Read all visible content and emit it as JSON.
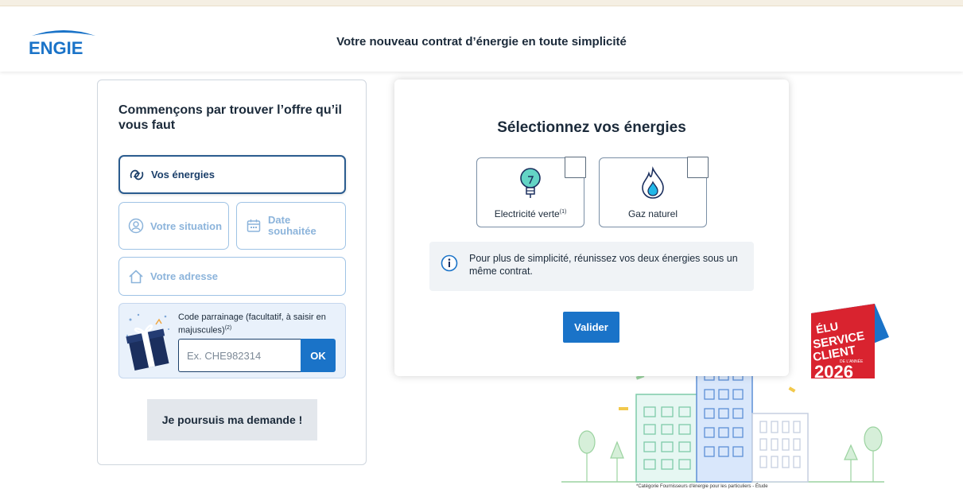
{
  "header": {
    "brand": "ENGIE",
    "title": "Votre nouveau contrat d’énergie en toute simplicité"
  },
  "left_panel": {
    "title": "Commençons par trouver l’offre qu’il vous faut",
    "steps": {
      "energies": "Vos énergies",
      "situation": "Votre situation",
      "date": "Date souhaitée",
      "adresse": "Votre adresse"
    },
    "promo": {
      "label": "Code parrainage (facultatif, à saisir en majuscules)",
      "label_note": "(2)",
      "placeholder": "Ex. CHE982314",
      "ok": "OK"
    },
    "continue": "Je poursuis ma demande !"
  },
  "modal": {
    "title": "Sélectionnez vos énergies",
    "options": {
      "elec": "Electricité verte",
      "elec_note": "(1)",
      "gaz": "Gaz naturel"
    },
    "info": "Pour plus de simplicité, réunissez vos deux énergies sous un même contrat.",
    "validate": "Valider"
  },
  "badge": {
    "line1": "ÉLU",
    "line2": "SERVICE",
    "line3": "CLIENT",
    "line4": "DE L'ANNÉE",
    "year": "2026"
  },
  "footnote": "*Catégorie Fournisseurs d'énergie pour les particuliers - Étude",
  "colors": {
    "primary": "#1a73c8",
    "navy": "#1b3f6a",
    "badge_red": "#d9232f",
    "badge_blue": "#1a73c8"
  },
  "icons": {
    "energies": "energy-swirl-icon",
    "situation": "user-icon",
    "date": "calendar-icon",
    "adresse": "home-icon",
    "elec": "lightbulb-icon",
    "gaz": "flame-icon",
    "info": "info-icon",
    "gift": "gift-icon"
  }
}
